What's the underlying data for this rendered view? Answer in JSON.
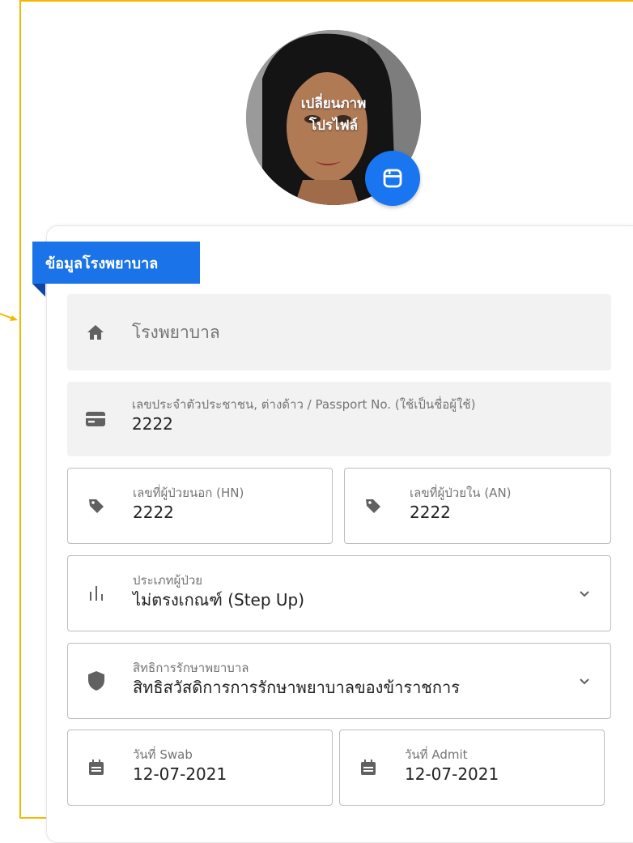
{
  "avatar": {
    "change_text_line1": "เปลี่ยนภาพ",
    "change_text_line2": "โปรไฟล์",
    "button_icon": "save-icon"
  },
  "section": {
    "title": "ข้อมูลโรงพยาบาล"
  },
  "hospital": {
    "placeholder": "โรงพยาบาล",
    "icon": "home-icon"
  },
  "citizen_id": {
    "label": "เลขประจำตัวประชาชน, ต่างด้าว / Passport No. (ใช้เป็นชื่อผู้ใช้)",
    "value": "2222",
    "icon": "id-card-icon"
  },
  "hn": {
    "label": "เลขที่ผู้ป่วยนอก (HN)",
    "value": "2222",
    "icon": "tag-icon"
  },
  "an": {
    "label": "เลขที่ผู้ป่วยใน (AN)",
    "value": "2222",
    "icon": "tag-icon"
  },
  "patient_type": {
    "label": "ประเภทผู้ป่วย",
    "value": "ไม่ตรงเกณฑ์ (Step Up)",
    "icon": "bars-icon"
  },
  "coverage": {
    "label": "สิทธิการรักษาพยาบาล",
    "value": "สิทธิสวัสดิการการรักษาพยาบาลของข้าราชการ",
    "icon": "shield-icon"
  },
  "swab_date": {
    "label": "วันที่ Swab",
    "value": "12-07-2021",
    "icon": "calendar-icon"
  },
  "admit_date": {
    "label": "วันที่ Admit",
    "value": "12-07-2021",
    "icon": "calendar-icon"
  },
  "colors": {
    "accent": "#1a73e8",
    "frame": "#f5b800",
    "field_bg": "#f2f2f2",
    "icon": "#616161"
  }
}
